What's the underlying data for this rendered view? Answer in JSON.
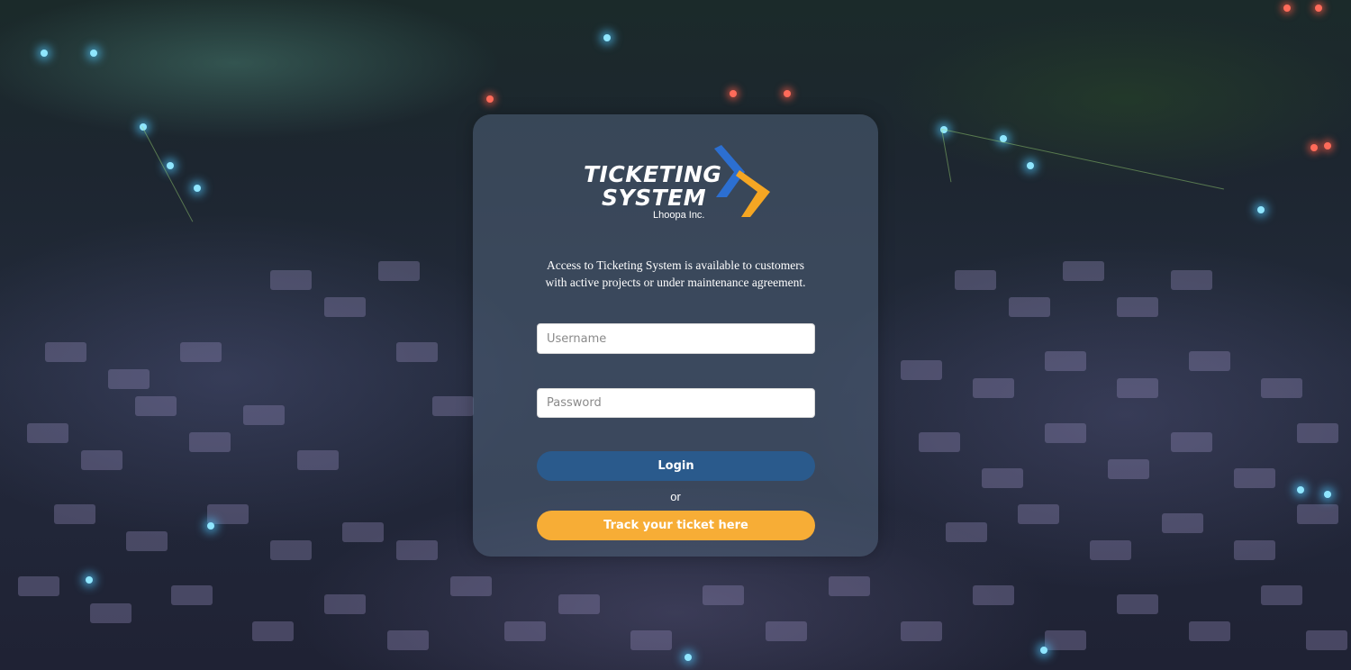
{
  "logo": {
    "title_line1": "TICKETING",
    "title_line2": "SYSTEM",
    "company": "Lhoopa Inc."
  },
  "intro": {
    "line1": "Access to Ticketing System is available to customers",
    "line2": "with active projects or under maintenance agreement."
  },
  "form": {
    "username_placeholder": "Username",
    "password_placeholder": "Password",
    "login_label": "Login",
    "or_label": "or",
    "track_label": "Track your ticket here"
  },
  "colors": {
    "login_button": "#2a5a8c",
    "track_button": "#f7ad36",
    "logo_chevron_blue": "#2c6fd1",
    "logo_chevron_orange": "#f5a623"
  }
}
